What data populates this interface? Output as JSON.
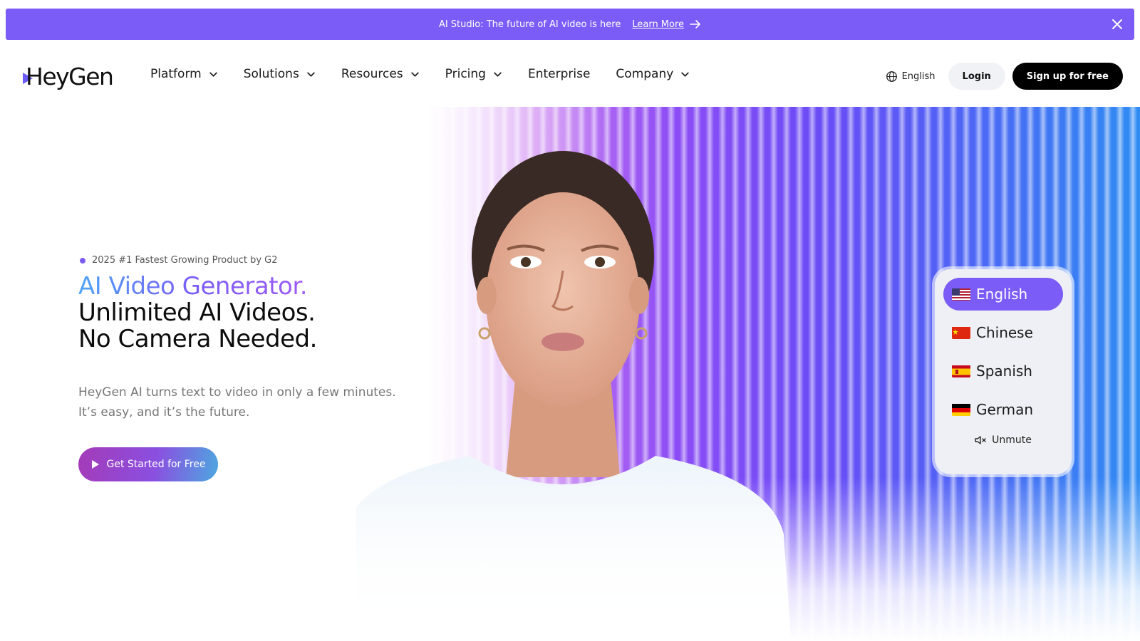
{
  "announcement": {
    "text": "AI Studio: The future of AI video is here",
    "link_label": "Learn More",
    "close_icon": "close-icon",
    "background": "#7b5cf6"
  },
  "header": {
    "logo_text": "HeyGen",
    "nav": [
      {
        "label": "Platform",
        "has_dropdown": true
      },
      {
        "label": "Solutions",
        "has_dropdown": true
      },
      {
        "label": "Resources",
        "has_dropdown": true
      },
      {
        "label": "Pricing",
        "has_dropdown": true
      },
      {
        "label": "Enterprise",
        "has_dropdown": false
      },
      {
        "label": "Company",
        "has_dropdown": true
      }
    ],
    "language_label": "English",
    "login_label": "Login",
    "signup_label": "Sign up for free"
  },
  "hero": {
    "badge": "2025 #1 Fastest Growing Product by G2",
    "headline_line1": "AI Video Generator.",
    "headline_line2": "Unlimited AI Videos.",
    "headline_line3": "No Camera Needed.",
    "description_line1": "HeyGen AI turns text to video in only a few minutes.",
    "description_line2": "It’s easy, and it’s the future.",
    "cta_label": "Get Started for Free"
  },
  "language_selector": {
    "options": [
      {
        "label": "English",
        "flag": "us-flag-icon",
        "selected": true
      },
      {
        "label": "Chinese",
        "flag": "cn-flag-icon",
        "selected": false
      },
      {
        "label": "Spanish",
        "flag": "es-flag-icon",
        "selected": false
      },
      {
        "label": "German",
        "flag": "de-flag-icon",
        "selected": false
      }
    ],
    "unmute_label": "Unmute"
  },
  "colors": {
    "accent": "#7b5cf6",
    "button_dark": "#000000"
  }
}
